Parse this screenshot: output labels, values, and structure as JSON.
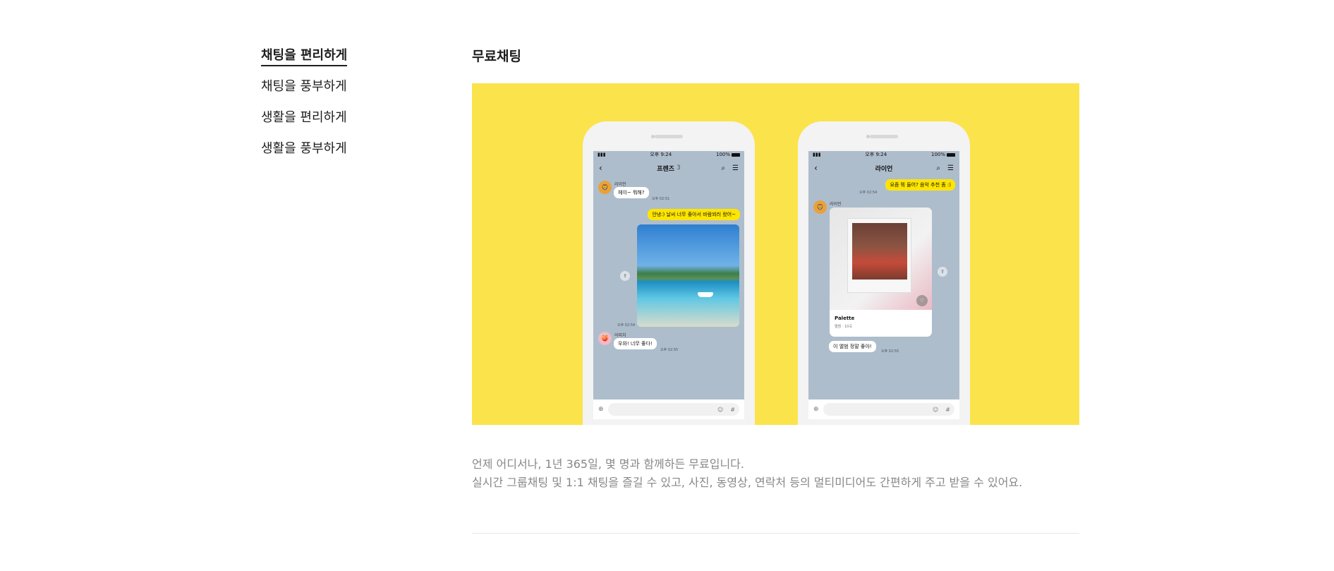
{
  "nav": {
    "items": [
      {
        "label": "채팅을 편리하게",
        "active": true
      },
      {
        "label": "채팅을 풍부하게",
        "active": false
      },
      {
        "label": "생활을 편리하게",
        "active": false
      },
      {
        "label": "생활을 풍부하게",
        "active": false
      }
    ]
  },
  "section": {
    "title": "무료채팅",
    "hero_color": "#fbe34c",
    "description": [
      "언제 어디서나, 1년 365일, 몇 명과 함께하든 무료입니다.",
      "실시간 그룹채팅 및 1:1 채팅을 즐길 수 있고, 사진, 동영상, 연락처 등의 멀티미디어도 간편하게 주고 받을 수 있어요."
    ]
  },
  "phone1": {
    "status": {
      "time": "오후 9:24",
      "battery": "100%"
    },
    "header": {
      "title": "프렌즈",
      "count": "3"
    },
    "sender1": "라이언",
    "msg1": "헤이~ 뭐해?",
    "time1": "오후 02:51",
    "msg2": "안녕:) 날씨 너무 좋아서 바람쐬러 왔어~",
    "time2": "오후 02:54",
    "sender2": "어피치",
    "msg3": "우와! 너무 좋다!",
    "time3": "오후 02:55"
  },
  "phone2": {
    "status": {
      "time": "오후 9:24",
      "battery": "100%"
    },
    "header": {
      "title": "라이언"
    },
    "msg1": "요즘 뭐 들어? 음악 추천 좀 :)",
    "time1": "오후 02:54",
    "sender1": "라이언",
    "album_title": "Palette",
    "album_meta": "앨범 · 10곡",
    "msg2": "이 앨범 정말 좋아!",
    "time2": "오후 02:55"
  }
}
